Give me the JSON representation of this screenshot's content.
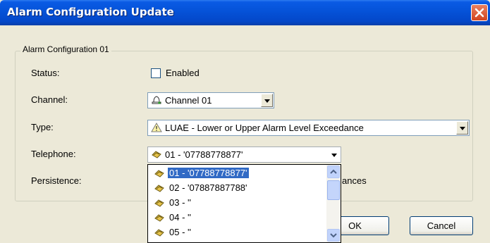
{
  "window": {
    "title": "Alarm Configuration Update"
  },
  "group": {
    "legend": "Alarm Configuration 01"
  },
  "labels": {
    "status": "Status:",
    "channel": "Channel:",
    "type": "Type:",
    "telephone": "Telephone:",
    "persistence": "Persistence:"
  },
  "status": {
    "checkbox_label": "Enabled",
    "checked": false
  },
  "channel": {
    "value": "Channel 01",
    "icon": "channel-icon"
  },
  "type": {
    "value": "LUAE - Lower or Upper Alarm Level Exceedance",
    "icon": "warning-triangle-icon"
  },
  "telephone": {
    "value": "01  -  '07788778877'",
    "icon": "telephone-icon",
    "options": [
      {
        "label": "01  -  '07788778877'",
        "selected": true
      },
      {
        "label": "02  -  '07887887788'",
        "selected": false
      },
      {
        "label": "03  -  ''",
        "selected": false
      },
      {
        "label": "04  -  ''",
        "selected": false
      },
      {
        "label": "05  -  ''",
        "selected": false
      }
    ]
  },
  "persistence": {
    "partial_text": "ances"
  },
  "buttons": {
    "ok": "OK",
    "cancel": "Cancel"
  },
  "colors": {
    "title_bar": "#0552D8",
    "selection": "#316AC5",
    "dialog_bg": "#ECE9D8"
  }
}
